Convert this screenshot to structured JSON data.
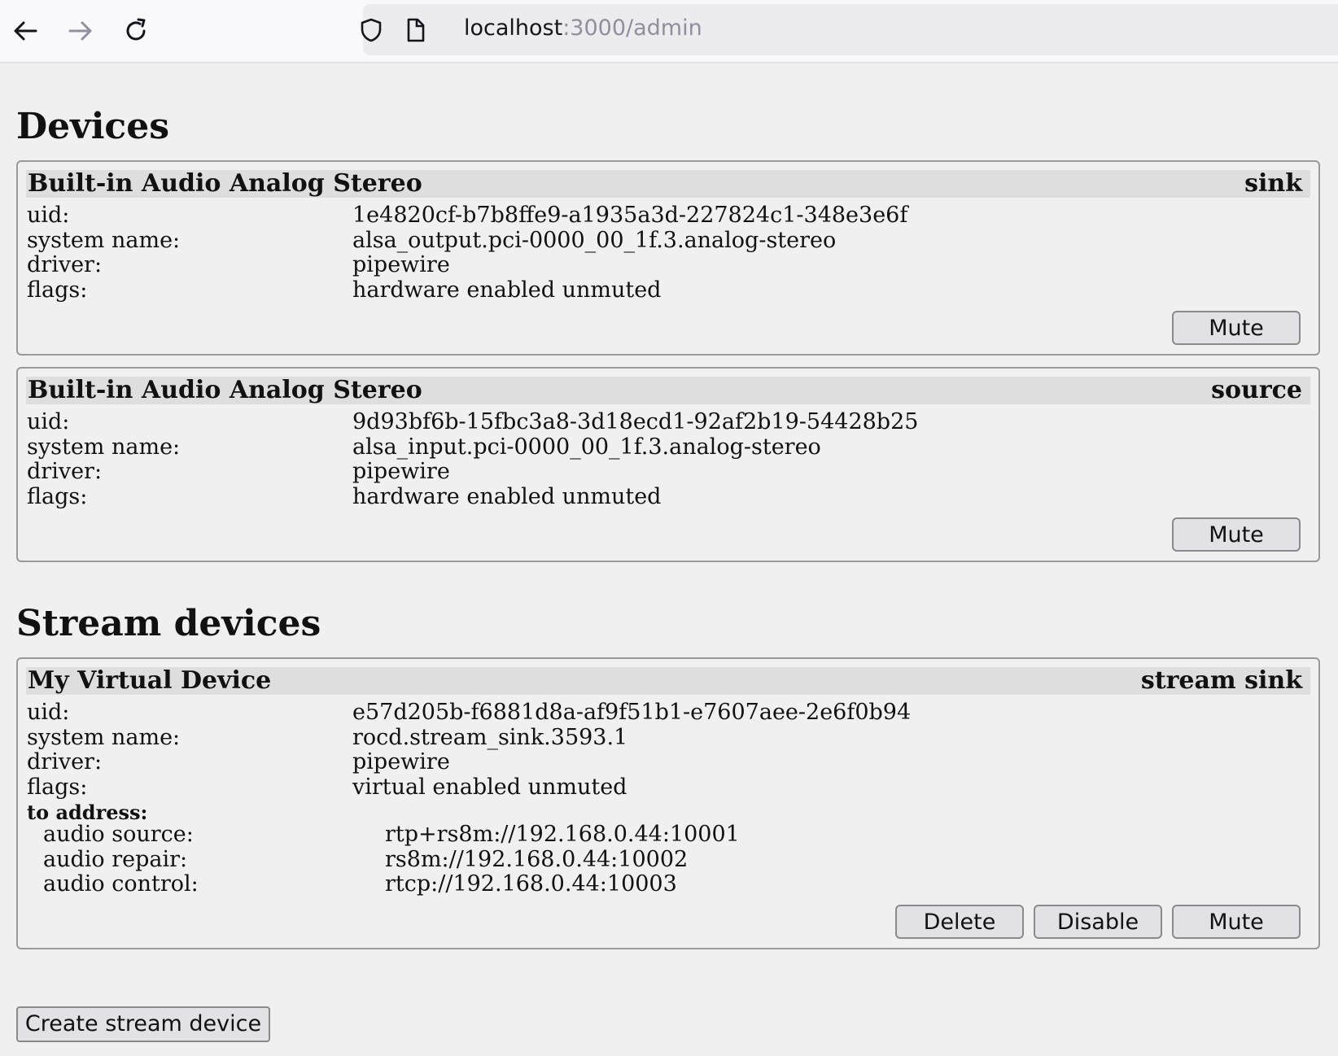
{
  "browser": {
    "url_host": "localhost",
    "url_path": ":3000/admin"
  },
  "devices_heading": "Devices",
  "devices": [
    {
      "name": "Built-in Audio Analog Stereo",
      "kind": "sink",
      "fields": [
        {
          "label": "uid:",
          "value": "1e4820cf-b7b8ffe9-a1935a3d-227824c1-348e3e6f"
        },
        {
          "label": "system name:",
          "value": "alsa_output.pci-0000_00_1f.3.analog-stereo"
        },
        {
          "label": "driver:",
          "value": "pipewire"
        },
        {
          "label": "flags:",
          "value": "hardware enabled unmuted"
        }
      ],
      "mute_label": "Mute"
    },
    {
      "name": "Built-in Audio Analog Stereo",
      "kind": "source",
      "fields": [
        {
          "label": "uid:",
          "value": "9d93bf6b-15fbc3a8-3d18ecd1-92af2b19-54428b25"
        },
        {
          "label": "system name:",
          "value": "alsa_input.pci-0000_00_1f.3.analog-stereo"
        },
        {
          "label": "driver:",
          "value": "pipewire"
        },
        {
          "label": "flags:",
          "value": "hardware enabled unmuted"
        }
      ],
      "mute_label": "Mute"
    }
  ],
  "stream_heading": "Stream devices",
  "stream_device": {
    "name": "My Virtual Device",
    "kind": "stream sink",
    "fields": [
      {
        "label": "uid:",
        "value": "e57d205b-f6881d8a-af9f51b1-e7607aee-2e6f0b94"
      },
      {
        "label": "system name:",
        "value": "rocd.stream_sink.3593.1"
      },
      {
        "label": "driver:",
        "value": "pipewire"
      },
      {
        "label": "flags:",
        "value": "virtual enabled unmuted"
      }
    ],
    "to_address_label": "to address:",
    "addresses": [
      {
        "label": "audio source:",
        "value": "rtp+rs8m://192.168.0.44:10001"
      },
      {
        "label": "audio repair:",
        "value": "rs8m://192.168.0.44:10002"
      },
      {
        "label": "audio control:",
        "value": "rtcp://192.168.0.44:10003"
      }
    ],
    "delete_label": "Delete",
    "disable_label": "Disable",
    "mute_label": "Mute"
  },
  "create_button_label": "Create stream device"
}
